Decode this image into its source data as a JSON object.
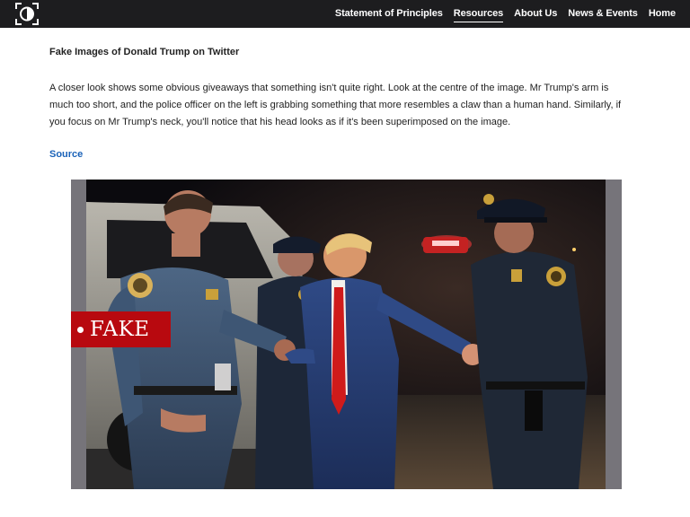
{
  "nav": {
    "logo_icon": "aperture-logo-icon",
    "items": [
      {
        "label": "Statement of Principles",
        "active": false
      },
      {
        "label": "Resources",
        "active": true
      },
      {
        "label": "About Us",
        "active": false
      },
      {
        "label": "News & Events",
        "active": false
      },
      {
        "label": "Home",
        "active": false
      }
    ]
  },
  "article": {
    "title": "Fake Images of Donald Trump on Twitter",
    "body": "A closer look shows some obvious giveaways that something isn't quite right. Look at the centre of the image. Mr Trump's arm is much too short, and the police officer on the left is grabbing something that more resembles a claw than a human hand. Similarly, if you focus on Mr Trump's neck, you'll notice that his head looks as if it's been superimposed on the image.",
    "source_link": "Source"
  },
  "image": {
    "badge": "FAKE",
    "badge_color": "#b8090f"
  },
  "colors": {
    "topbar": "#1d1d1f",
    "link": "#1a62b8"
  }
}
